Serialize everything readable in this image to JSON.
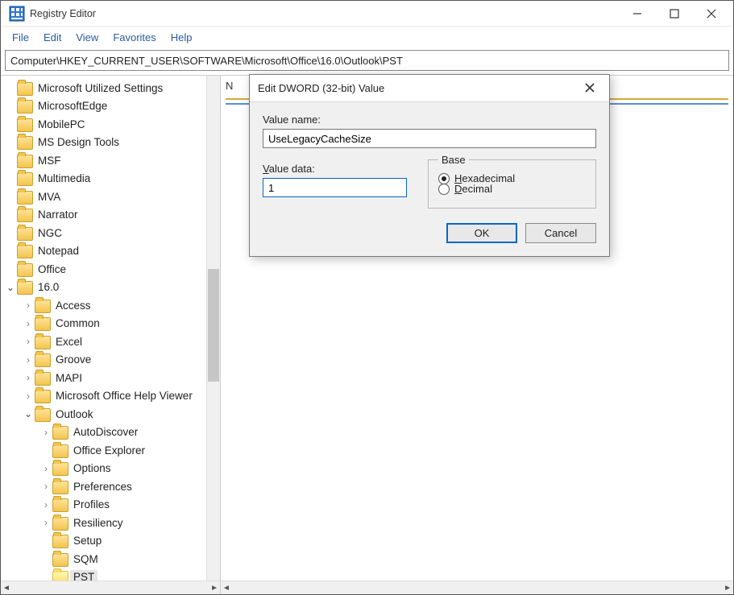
{
  "window": {
    "title": "Registry Editor"
  },
  "menu": {
    "file": "File",
    "edit": "Edit",
    "view": "View",
    "favorites": "Favorites",
    "help": "Help"
  },
  "address": "Computer\\HKEY_CURRENT_USER\\SOFTWARE\\Microsoft\\Office\\16.0\\Outlook\\PST",
  "rightpane": {
    "header": "N"
  },
  "tree": [
    {
      "level": 1,
      "label": "Microsoft Utilized Settings",
      "arrow": ""
    },
    {
      "level": 1,
      "label": "MicrosoftEdge",
      "arrow": ""
    },
    {
      "level": 1,
      "label": "MobilePC",
      "arrow": ""
    },
    {
      "level": 1,
      "label": "MS Design Tools",
      "arrow": ""
    },
    {
      "level": 1,
      "label": "MSF",
      "arrow": ""
    },
    {
      "level": 1,
      "label": "Multimedia",
      "arrow": ""
    },
    {
      "level": 1,
      "label": "MVA",
      "arrow": ""
    },
    {
      "level": 1,
      "label": "Narrator",
      "arrow": ""
    },
    {
      "level": 1,
      "label": "NGC",
      "arrow": ""
    },
    {
      "level": 1,
      "label": "Notepad",
      "arrow": ""
    },
    {
      "level": 1,
      "label": "Office",
      "arrow": ""
    },
    {
      "level": 1,
      "label": "16.0",
      "arrow": "down"
    },
    {
      "level": 2,
      "label": "Access",
      "arrow": "right"
    },
    {
      "level": 2,
      "label": "Common",
      "arrow": "right"
    },
    {
      "level": 2,
      "label": "Excel",
      "arrow": "right"
    },
    {
      "level": 2,
      "label": "Groove",
      "arrow": "right"
    },
    {
      "level": 2,
      "label": "MAPI",
      "arrow": "right"
    },
    {
      "level": 2,
      "label": "Microsoft Office Help Viewer",
      "arrow": "right"
    },
    {
      "level": 2,
      "label": "Outlook",
      "arrow": "down"
    },
    {
      "level": 3,
      "label": "AutoDiscover",
      "arrow": "right"
    },
    {
      "level": 3,
      "label": "Office Explorer",
      "arrow": ""
    },
    {
      "level": 3,
      "label": "Options",
      "arrow": "right"
    },
    {
      "level": 3,
      "label": "Preferences",
      "arrow": "right"
    },
    {
      "level": 3,
      "label": "Profiles",
      "arrow": "right"
    },
    {
      "level": 3,
      "label": "Resiliency",
      "arrow": "right"
    },
    {
      "level": 3,
      "label": "Setup",
      "arrow": ""
    },
    {
      "level": 3,
      "label": "SQM",
      "arrow": ""
    },
    {
      "level": 3,
      "label": "PST",
      "arrow": "",
      "selected": true
    }
  ],
  "dialog": {
    "title": "Edit DWORD (32-bit) Value",
    "valueNameLabel": "Value name:",
    "valueName": "UseLegacyCacheSize",
    "valueDataLabel": "Value data:",
    "valueDataPrefix": "V",
    "valueData": "1",
    "baseLabel": "Base",
    "hexLabel": "Hexadecimal",
    "hexPrefix": "H",
    "decLabel": "Decimal",
    "decPrefix": "D",
    "ok": "OK",
    "cancel": "Cancel"
  }
}
